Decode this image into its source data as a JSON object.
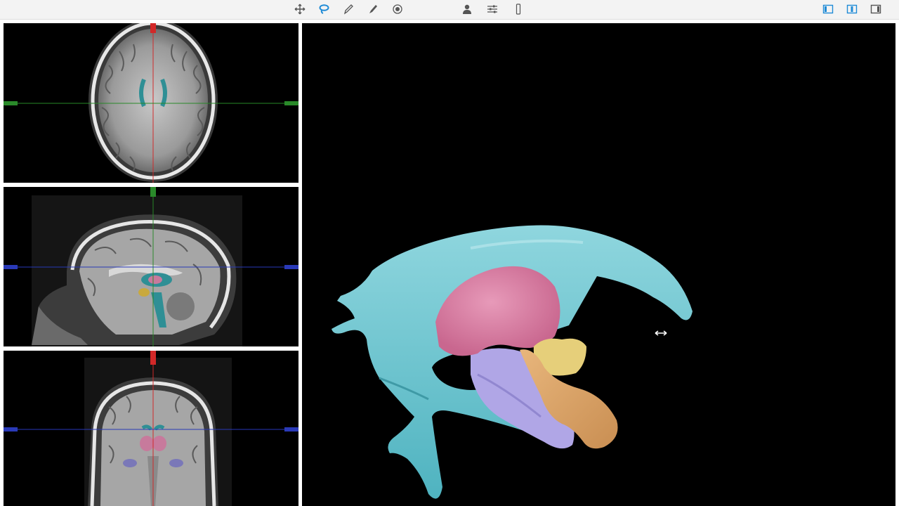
{
  "toolbar": {
    "left_tools": [
      {
        "icon": "move-icon",
        "active": false
      },
      {
        "icon": "lasso-icon",
        "active": true
      },
      {
        "icon": "pen-icon",
        "active": false
      },
      {
        "icon": "brush-icon",
        "active": false
      },
      {
        "icon": "record-icon",
        "active": false
      }
    ],
    "middle_tools": [
      {
        "icon": "person-icon"
      },
      {
        "icon": "sliders-icon"
      },
      {
        "icon": "slab-icon"
      }
    ],
    "layout_tools": [
      {
        "icon": "layout-left-icon"
      },
      {
        "icon": "layout-center-icon"
      },
      {
        "icon": "layout-right-icon"
      }
    ]
  },
  "viewports": {
    "axial": "axial-view",
    "sagittal": "sagittal-view",
    "coronal": "coronal-view",
    "render": "3d-render-view"
  },
  "cursor": "resize-horizontal-cursor",
  "colors": {
    "accent": "#1f8bd6",
    "ventricles": "#6ec7d1",
    "thalamus": "#d67aa0",
    "hippocampus": "#b0a6e6",
    "amygdala": "#e6cf7a",
    "brainstem": "#dba36e",
    "crosshair_red": "#d22828",
    "crosshair_green": "#2a8a2a",
    "crosshair_blue": "#2a3ab8"
  }
}
